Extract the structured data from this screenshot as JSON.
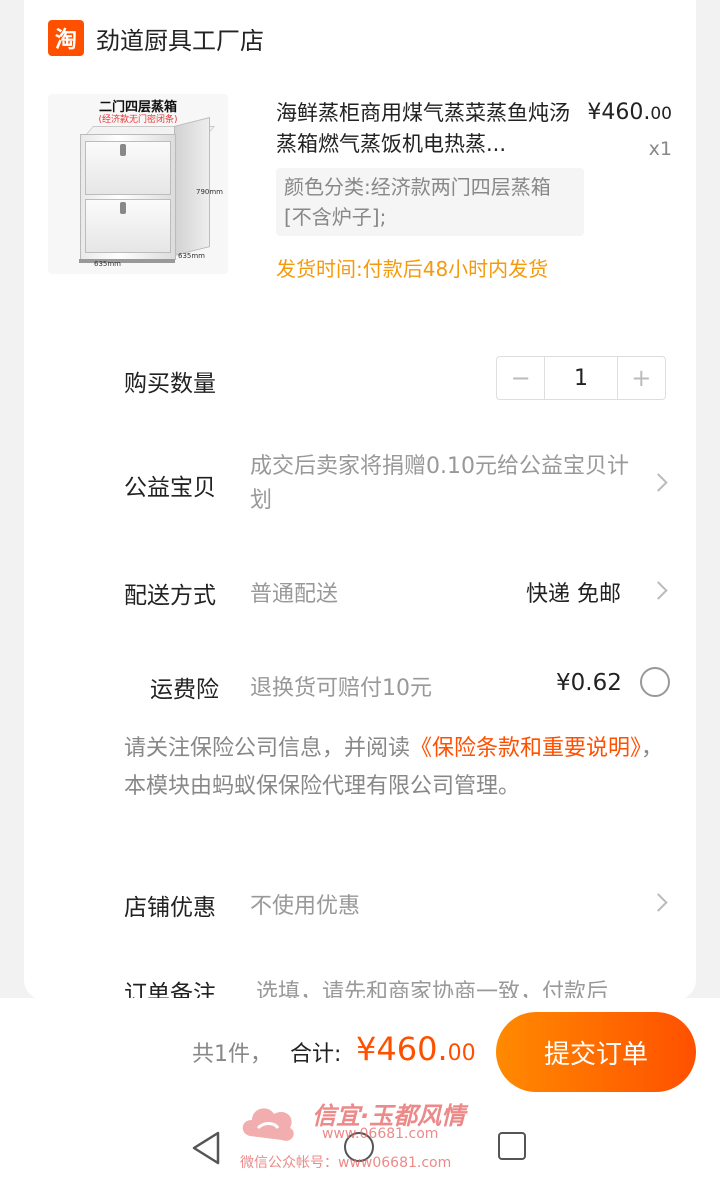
{
  "shop": {
    "logo_char": "淘",
    "name": "劲道厨具工厂店"
  },
  "product": {
    "image": {
      "title": "二门四层蒸箱",
      "subtitle": "(经济款无门密闭条)",
      "dim_height": "790mm",
      "dim_width": "635mm",
      "dim_depth": "635mm"
    },
    "title": "海鲜蒸柜商用煤气蒸菜蒸鱼炖汤蒸箱燃气蒸饭机电热蒸...",
    "price_main": "¥460.",
    "price_cents": "00",
    "quantity_label": "x1",
    "sku": "颜色分类:经济款两门四层蒸箱[不含炉子];",
    "ship_time": "发货时间:付款后48小时内发货"
  },
  "quantity": {
    "label": "购买数量",
    "minus": "−",
    "value": "1",
    "plus": "+"
  },
  "charity": {
    "label": "公益宝贝",
    "text": "成交后卖家将捐赠0.10元给公益宝贝计划"
  },
  "delivery": {
    "label": "配送方式",
    "method": "普通配送",
    "value": "快递 免邮"
  },
  "insurance": {
    "label": "运费险",
    "desc": "退换货可赔付10元",
    "price": "¥0.62",
    "note_prefix": "请关注保险公司信息，并阅读",
    "note_link": "《保险条款和重要说明》",
    "note_suffix": "，本模块由蚂蚁保保险代理有限公司管理。"
  },
  "coupon": {
    "label": "店铺优惠",
    "value": "不使用优惠"
  },
  "remark": {
    "label": "订单备注",
    "placeholder": "选填，请先和商家协商一致，付款后"
  },
  "footer": {
    "count": "共1件，",
    "total_label": "合计:",
    "total_main": "¥460.",
    "total_cents": "00",
    "submit": "提交订单"
  },
  "watermark": {
    "title": "信宜·玉都风情",
    "url": "www.06681.com",
    "wechat": "微信公众帐号：www06681.com"
  },
  "colors": {
    "accent": "#ff5000",
    "ship_time": "#f59a0c",
    "muted": "#999999"
  }
}
